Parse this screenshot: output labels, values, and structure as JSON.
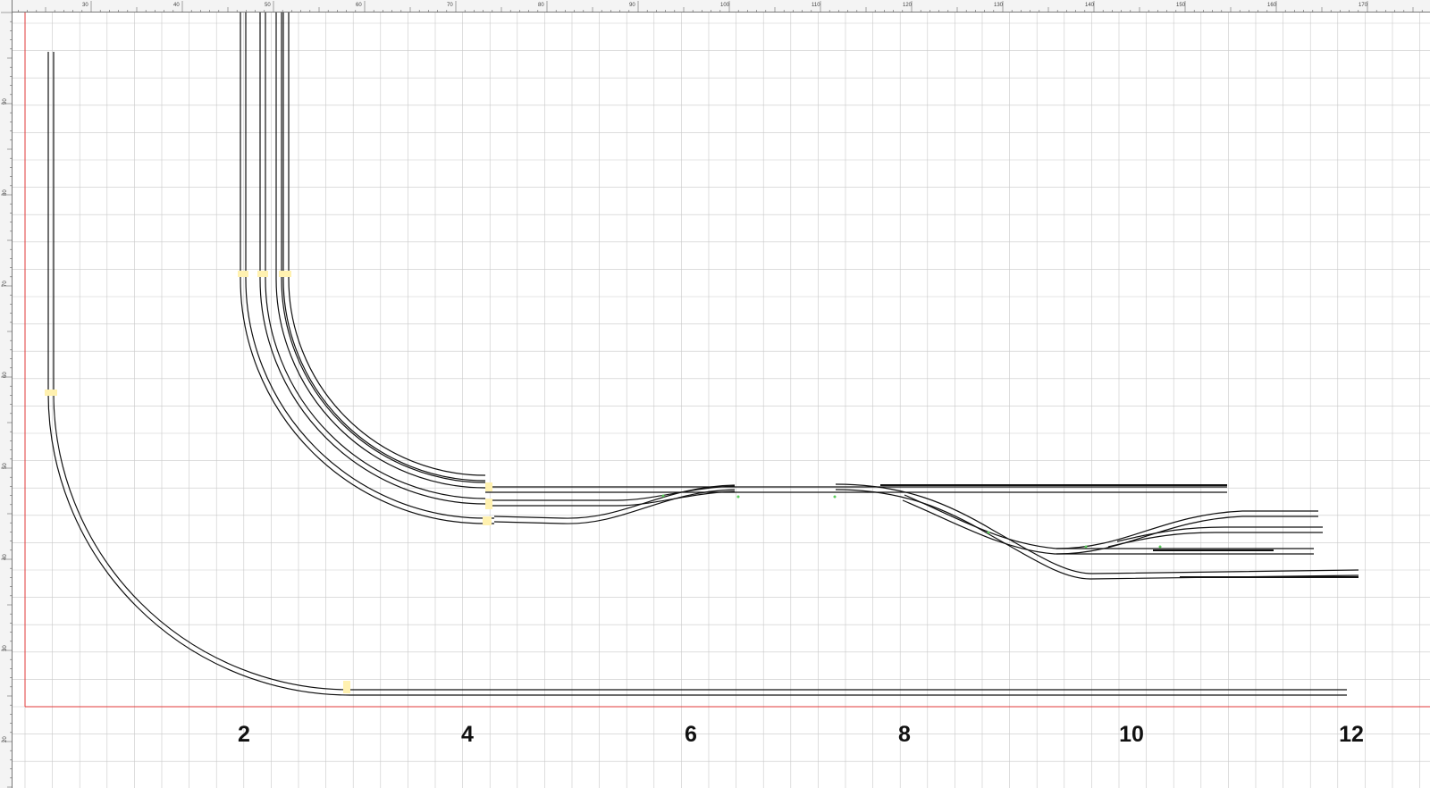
{
  "editor": {
    "grid_color": "#c9c9c9",
    "major_grid_color": "#a8a8a8",
    "origin_line_color": "#e03a3a",
    "track_color": "#111111",
    "joint_color": "#fff1b0",
    "marker_color": "#5ccc5c"
  },
  "ruler_top": {
    "labels": [
      "30",
      "40",
      "50",
      "60",
      "70",
      "80",
      "90",
      "100",
      "110",
      "120",
      "130",
      "140",
      "150",
      "160",
      "170"
    ]
  },
  "ruler_left": {
    "labels": [
      "90",
      "80",
      "70",
      "60",
      "50",
      "40",
      "30",
      "20"
    ]
  },
  "axis_labels": [
    "2",
    "4",
    "6",
    "8",
    "10",
    "12"
  ],
  "layout_icons": [
    "track-segment",
    "curve-segment",
    "turnout",
    "track-joint",
    "connection-marker"
  ]
}
